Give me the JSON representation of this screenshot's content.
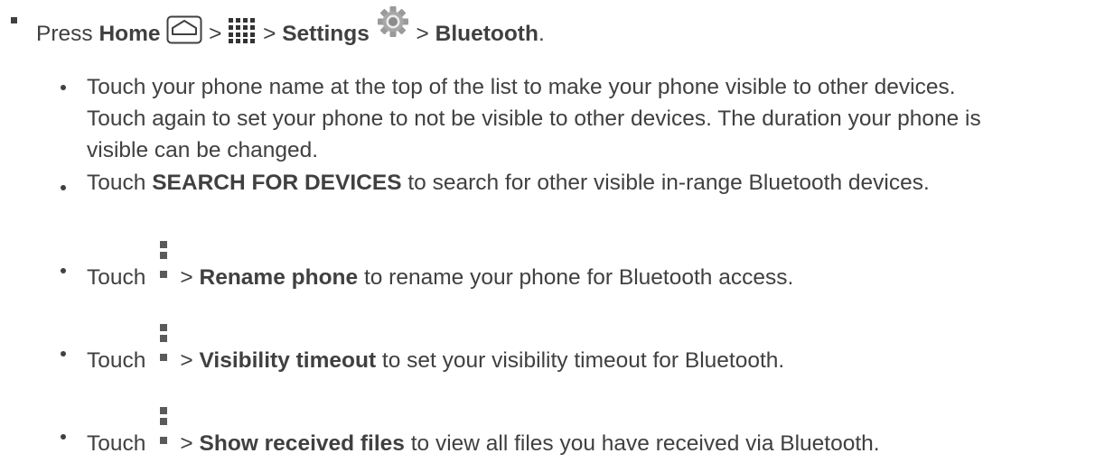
{
  "intro": {
    "press": "Press",
    "home": "Home",
    "gt1": ">",
    "gt2": ">",
    "settings": "Settings",
    "gt3": ">",
    "bluetooth": "Bluetooth",
    "period": "."
  },
  "icons": {
    "home": "home-key-icon",
    "apps": "apps-grid-icon",
    "settings": "gear-icon",
    "menu": "vertical-dots-menu-icon"
  },
  "items": [
    {
      "line1": "Touch your phone name at the top of the list to make your phone visible to other devices.",
      "line2": "Touch again to set your phone to not be visible to other devices. The duration your phone is",
      "line3": "visible can be changed."
    },
    {
      "pre": "Touch ",
      "bold": "SEARCH FOR DEVICES",
      "post": " to search for other visible in-range Bluetooth devices."
    },
    {
      "pre": "Touch",
      "gt": ">",
      "bold": "Rename phone",
      "post": " to rename your phone for Bluetooth access."
    },
    {
      "pre": "Touch",
      "gt": ">",
      "bold": "Visibility timeout",
      "post": " to set your visibility timeout for Bluetooth."
    },
    {
      "pre": "Touch",
      "gt": ">",
      "bold": "Show received files",
      "post": " to view all files you have received via Bluetooth."
    }
  ]
}
